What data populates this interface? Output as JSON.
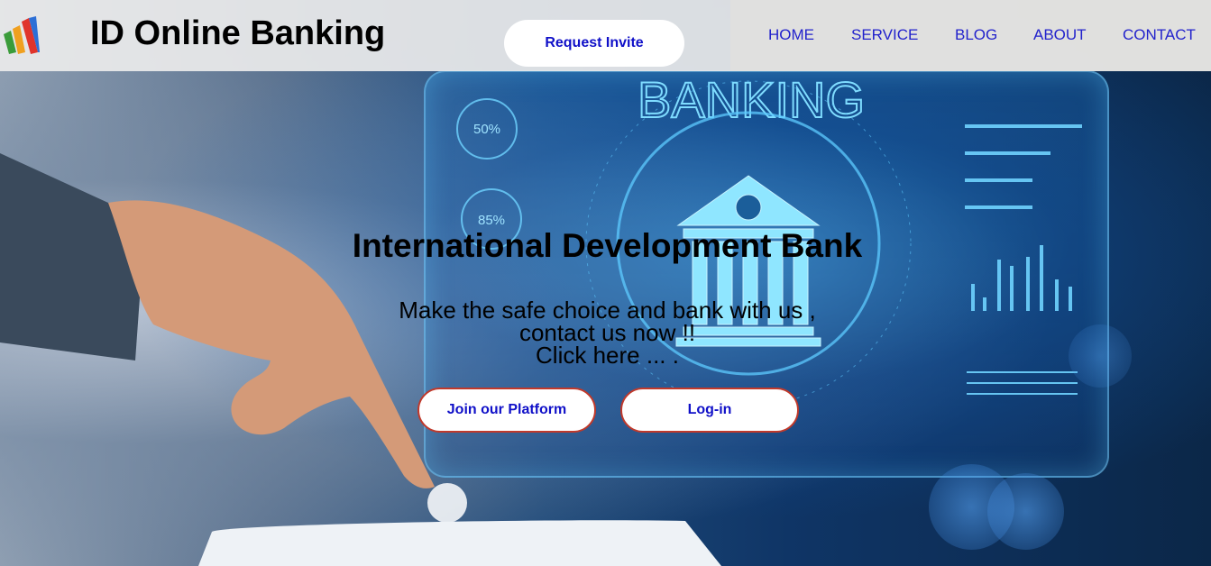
{
  "header": {
    "brand": "ID Online Banking",
    "invite_label": "Request Invite",
    "nav": [
      "HOME",
      "SERVICE",
      "BLOG",
      "ABOUT",
      "CONTACT"
    ]
  },
  "hero": {
    "background_word": "BANKING",
    "percent_a": "50%",
    "percent_b": "85%",
    "title": "International Development Bank",
    "sub_line1": "Make the safe choice and bank with us ,",
    "sub_line2": "contact us now !!",
    "sub_line3": "Click here ... .",
    "join_label": "Join our Platform",
    "login_label": "Log-in"
  },
  "colors": {
    "link": "#2222cc",
    "button_text": "#1010c8",
    "button_border": "#c0392b",
    "hero_accent": "#6fd3ff"
  },
  "icons": [
    "logo-icon",
    "bank-icon"
  ]
}
